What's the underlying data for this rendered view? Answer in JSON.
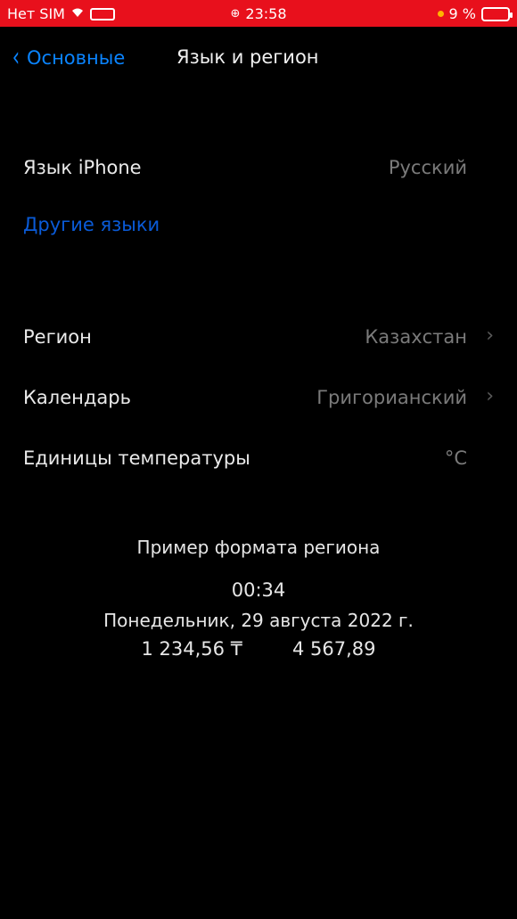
{
  "status_bar": {
    "carrier": "Нет SIM",
    "time": "23:58",
    "battery": "9 %",
    "wifi_icon": "wifi-icon",
    "alarm_icon": "alarm-icon"
  },
  "nav": {
    "back_label": "Основные",
    "title": "Язык и регион"
  },
  "language": {
    "label": "Язык iPhone",
    "value": "Русский",
    "other_link": "Другие языки"
  },
  "region_rows": [
    {
      "label": "Регион",
      "value": "Казахстан"
    },
    {
      "label": "Календарь",
      "value": "Григорианский"
    },
    {
      "label": "Единицы температуры",
      "value": "°C"
    }
  ],
  "format_example": {
    "title": "Пример формата региона",
    "time": "00:34",
    "date": "Понедельник, 29 августа 2022 г.",
    "currency": "1 234,56 ₸",
    "number": "4 567,89"
  },
  "colors": {
    "status_bar_bg": "#e8101c",
    "accent": "#0a84ff",
    "background": "#000000"
  }
}
